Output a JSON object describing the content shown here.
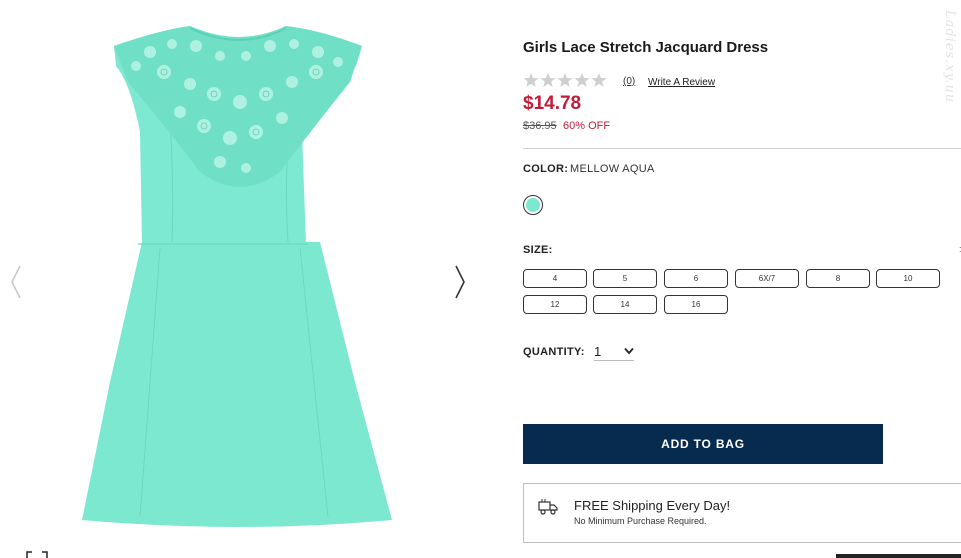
{
  "product": {
    "title": "Girls Lace Stretch Jacquard Dress",
    "rating_stars": 0,
    "review_count": "(0)",
    "write_review": "Write A Review",
    "price": "$14.78",
    "original_price": "$36.95",
    "discount": "60% OFF"
  },
  "color": {
    "label": "COLOR:",
    "value": "MELLOW AQUA",
    "swatch_color": "#7de8d0"
  },
  "size": {
    "label": "SIZE:",
    "side_mark": ":",
    "options": [
      "4",
      "5",
      "6",
      "6X/7",
      "8",
      "10",
      "12",
      "14",
      "16"
    ]
  },
  "quantity": {
    "label": "QUANTITY:",
    "value": "1"
  },
  "add_to_bag": "ADD TO BAG",
  "shipping": {
    "title": "FREE Shipping Every Day!",
    "subtitle": "No Minimum Purchase Required.",
    "icon": "truck-icon"
  },
  "gallery": {
    "prev_icon": "chevron-left-icon",
    "next_icon": "chevron-right-icon",
    "dress_color": "#7de8d0"
  },
  "watermark": "Ladies.xy.uu",
  "colors": {
    "price_red": "#c21c3a",
    "button_navy": "#072a4f"
  }
}
